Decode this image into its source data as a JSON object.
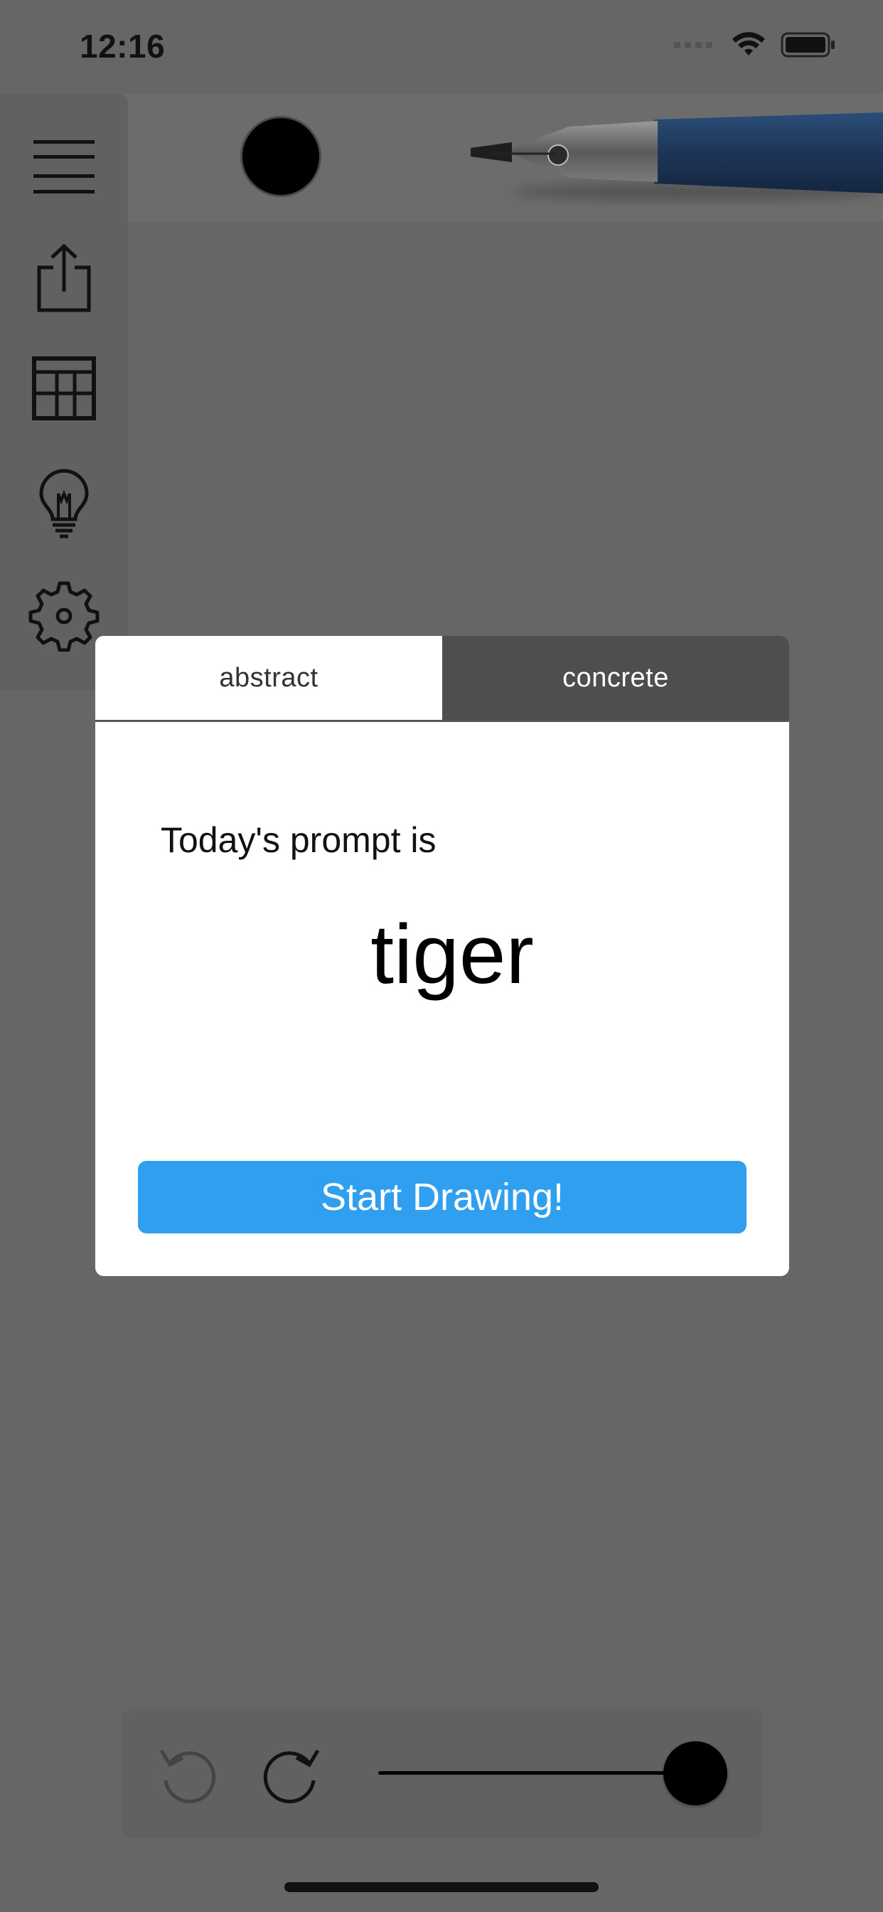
{
  "status_bar": {
    "time": "12:16",
    "icons": [
      "cellular-signal-icon",
      "wifi-icon",
      "battery-icon"
    ]
  },
  "toolbar": {
    "side_icons": [
      "menu-icon",
      "share-icon",
      "grid-icon",
      "lightbulb-icon",
      "gear-icon"
    ],
    "current_color": "#000000",
    "tool": "fountain-pen-icon"
  },
  "modal": {
    "tabs": [
      {
        "label": "abstract",
        "selected": true
      },
      {
        "label": "concrete",
        "selected": false
      }
    ],
    "prompt_intro": "Today's prompt is",
    "prompt_word": "tiger",
    "start_button": "Start Drawing!",
    "accent_color": "#309ff0"
  },
  "bottom_bar": {
    "icons": [
      "undo-icon",
      "redo-icon"
    ],
    "brush_size_fraction": 1.0
  }
}
